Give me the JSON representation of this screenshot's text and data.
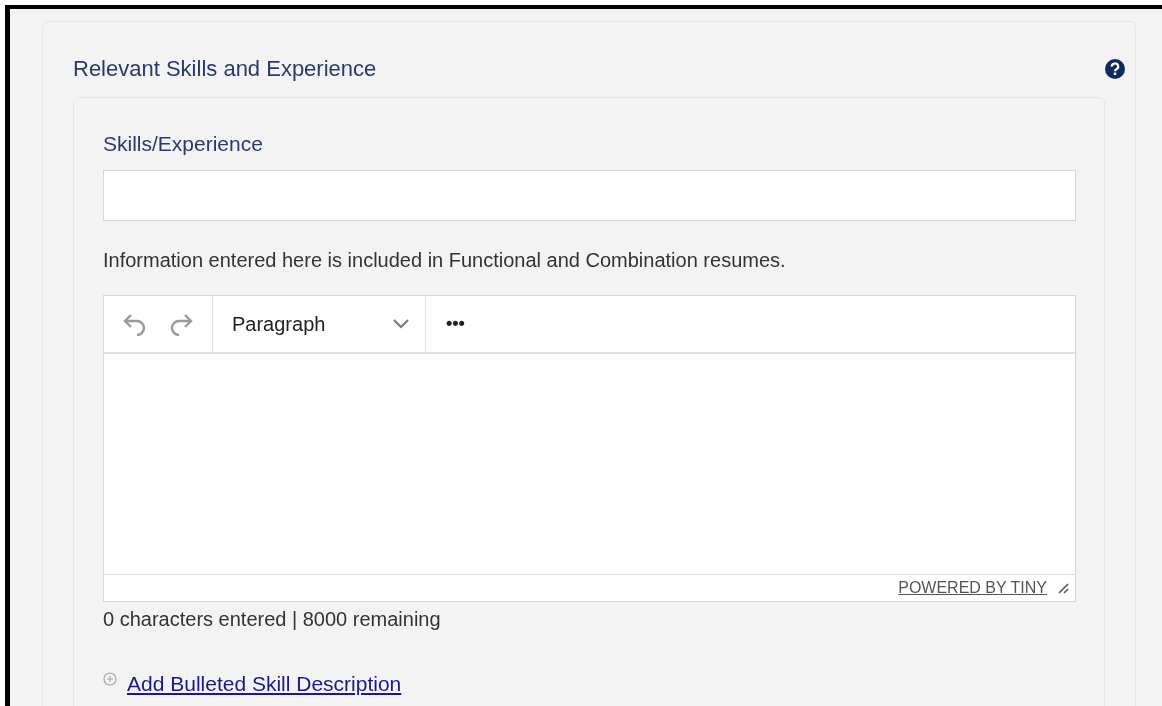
{
  "section": {
    "title": "Relevant Skills and Experience"
  },
  "field": {
    "label": "Skills/Experience"
  },
  "info": "Information entered here is included in Functional and Combination resumes.",
  "editor": {
    "block_format": "Paragraph",
    "more": "•••",
    "branding": "POWERED BY TINY"
  },
  "counter": "0 characters entered | 8000 remaining",
  "add_link": "Add Bulleted Skill Description"
}
